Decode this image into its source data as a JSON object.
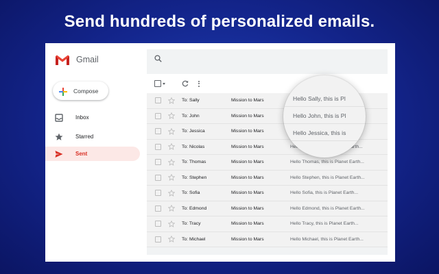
{
  "headline": "Send hundreds of personalized emails.",
  "app": {
    "name": "Gmail"
  },
  "sidebar": {
    "compose_label": "Compose",
    "items": [
      {
        "label": "Inbox",
        "icon": "inbox-icon",
        "active": false
      },
      {
        "label": "Starred",
        "icon": "star-icon",
        "active": false
      },
      {
        "label": "Sent",
        "icon": "send-icon",
        "active": true
      }
    ]
  },
  "colors": {
    "background": "#13248a",
    "active_nav_bg": "#fce8e6",
    "active_nav_text": "#d93025",
    "gmail_red": "#ea4335"
  },
  "emails": [
    {
      "to": "To: Sally",
      "subject": "Mission to Mars",
      "snippet": "Hello Sally, this is Planet Earth..."
    },
    {
      "to": "To: John",
      "subject": "Mission to Mars",
      "snippet": "Hello John, this is Planet Earth..."
    },
    {
      "to": "To: Jessica",
      "subject": "Mission to Mars",
      "snippet": "Hello Jessica, this is Planet Earth..."
    },
    {
      "to": "To: Nicolas",
      "subject": "Mission to Mars",
      "snippet": "Hello Nicolas, this is Planet Earth..."
    },
    {
      "to": "To: Thomas",
      "subject": "Mission to Mars",
      "snippet": "Hello Thomas, this is Planet Earth..."
    },
    {
      "to": "To: Stephen",
      "subject": "Mission to Mars",
      "snippet": "Hello Stephen, this is Planet Earth..."
    },
    {
      "to": "To: Sofia",
      "subject": "Mission to Mars",
      "snippet": "Hello Sofia, this is Planet Earth..."
    },
    {
      "to": "To: Edmond",
      "subject": "Mission to Mars",
      "snippet": "Hello Edmond, this is Planet Earth..."
    },
    {
      "to": "To: Tracy",
      "subject": "Mission to Mars",
      "snippet": "Hello Tracy, this is Planet Earth..."
    },
    {
      "to": "To: Michael",
      "subject": "Mission to Mars",
      "snippet": "Hello Michael, this is Planet Earth..."
    }
  ],
  "magnifier": {
    "lines": [
      "Hello Sally, this is Pl",
      "Hello John, this is Pl",
      "Hello Jessica, this is"
    ]
  }
}
